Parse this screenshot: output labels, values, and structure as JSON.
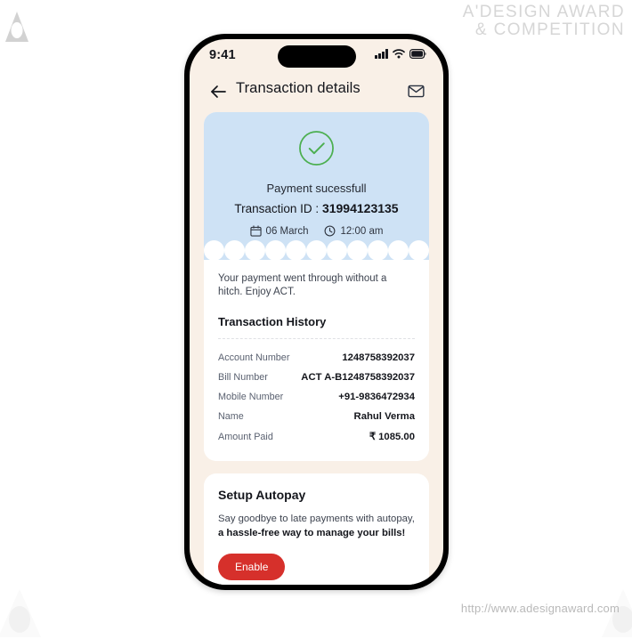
{
  "watermark": {
    "award_line1": "A'DESIGN AWARD",
    "award_line2": "& COMPETITION",
    "url": "http://www.adesignaward.com",
    "logo_icon": "a-design-award-logo-icon"
  },
  "phone": {
    "statusbar": {
      "time": "9:41",
      "signal_icon": "cellular-signal-icon",
      "wifi_icon": "wifi-icon",
      "battery_icon": "battery-full-icon"
    },
    "header": {
      "back_icon": "arrow-left-icon",
      "title": "Transaction details",
      "mail_icon": "envelope-icon"
    },
    "receipt": {
      "status_icon": "check-circle-icon",
      "status_color": "#4CAF50",
      "banner_color": "#CEE2F5",
      "status_text": "Payment sucessfull",
      "transaction_id_label": "Transaction ID : ",
      "transaction_id_value": "31994123135",
      "date_icon": "calendar-icon",
      "date": "06 March",
      "time_icon": "clock-icon",
      "time": "12:00 am",
      "note": "Your payment went through without a hitch. Enjoy ACT.",
      "history_title": "Transaction History",
      "rows": [
        {
          "label": "Account Number",
          "value": "1248758392037"
        },
        {
          "label": "Bill Number",
          "value": "ACT A-B1248758392037"
        },
        {
          "label": "Mobile Number",
          "value": "+91-9836472934"
        },
        {
          "label": "Name",
          "value": "Rahul Verma"
        },
        {
          "label": "Amount Paid",
          "value": "₹ 1085.00"
        }
      ]
    },
    "autopay": {
      "title": "Setup Autopay",
      "line1": "Say goodbye to late payments with autopay,",
      "line2": "a hassle-free way to manage your bills!",
      "button_label": "Enable",
      "button_color": "#D6302B"
    }
  }
}
